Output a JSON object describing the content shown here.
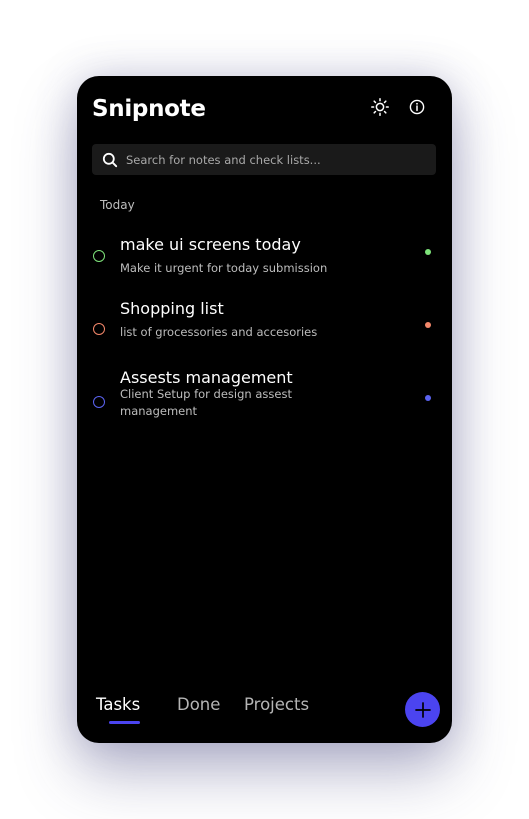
{
  "app": {
    "title": "Snipnote"
  },
  "search": {
    "placeholder": "Search for notes and check lists..."
  },
  "section": {
    "label": "Today"
  },
  "tasks": [
    {
      "title": "make ui screens today",
      "description": "Make it urgent for today submission",
      "color": "#7ee37a"
    },
    {
      "title": "Shopping list",
      "description": "list of grocessories and accesories",
      "color": "#f3876a"
    },
    {
      "title": "Assests management",
      "description": "Client Setup for design assest management",
      "color": "#5b63f0"
    }
  ],
  "tabs": [
    {
      "label": "Tasks",
      "active": true
    },
    {
      "label": "Done",
      "active": false
    },
    {
      "label": "Projects",
      "active": false
    }
  ],
  "icons": {
    "theme": "sun-icon",
    "info": "info-icon",
    "search": "search-icon",
    "add": "plus-icon"
  },
  "colors": {
    "accent": "#4b44f0",
    "background": "#000000",
    "search_background": "#1a1a1a",
    "text_primary": "#ffffff",
    "text_secondary": "#bdbdbd",
    "tab_inactive": "#b5b5b5"
  }
}
